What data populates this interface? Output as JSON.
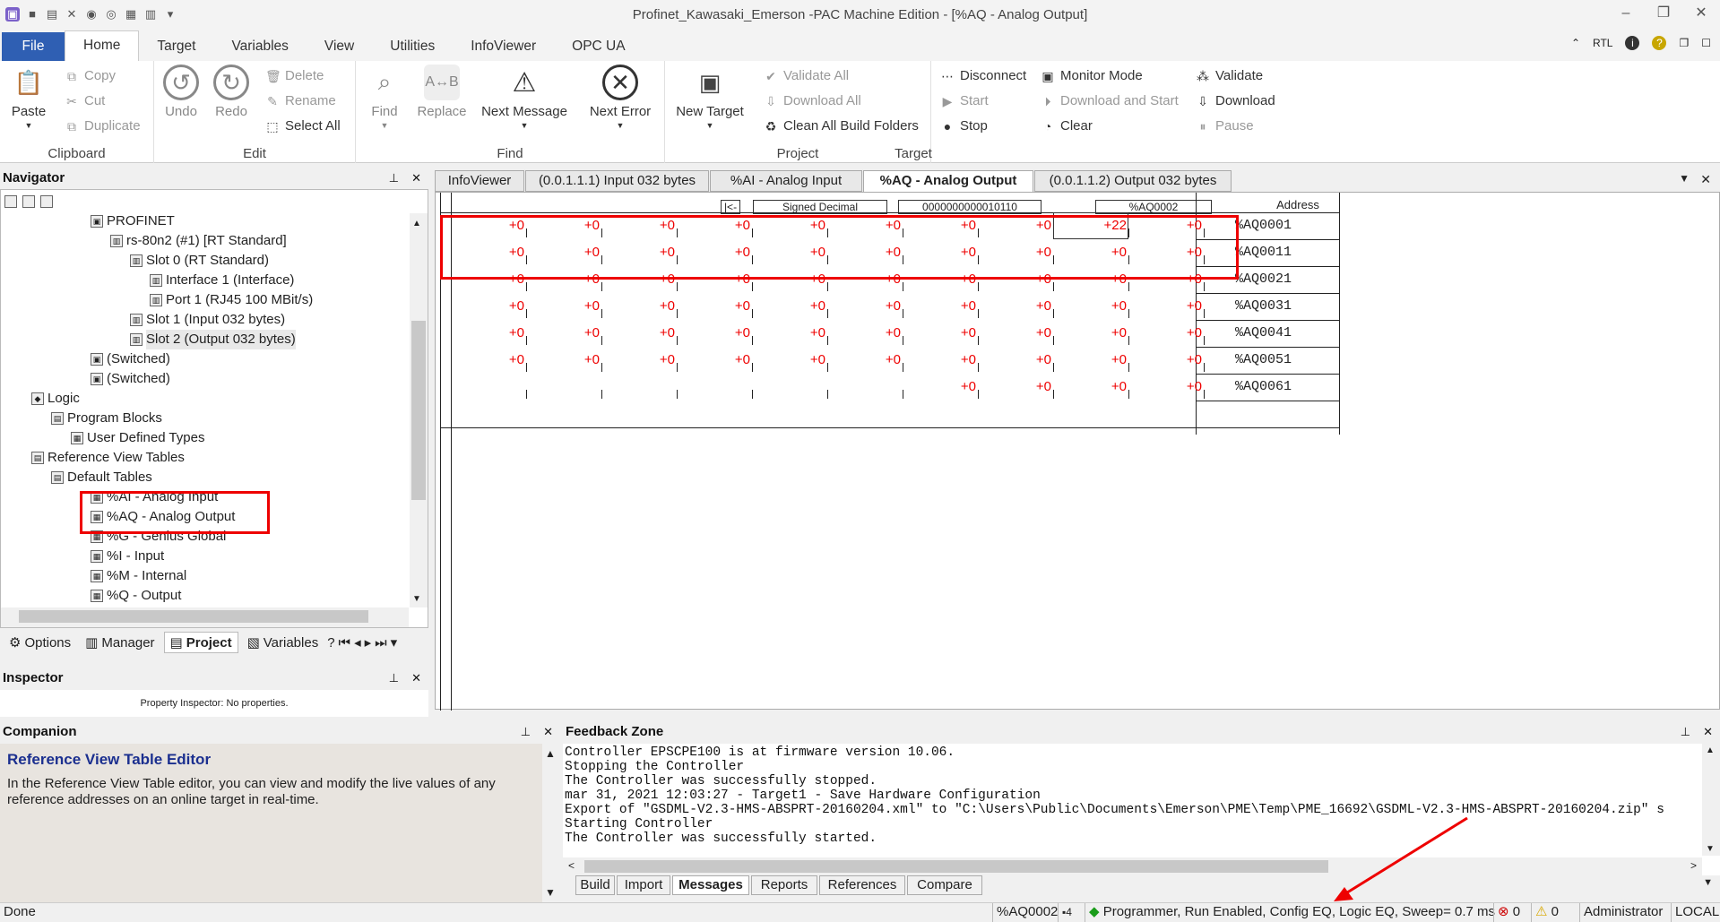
{
  "window": {
    "title": "Profinet_Kawasaki_Emerson -PAC Machine Edition - [%AQ - Analog Output]"
  },
  "ribbon_tabs": [
    "File",
    "Home",
    "Target",
    "Variables",
    "View",
    "Utilities",
    "InfoViewer",
    "OPC UA"
  ],
  "ribbon_right": {
    "rtl": "RTL"
  },
  "ribbon": {
    "clipboard": {
      "label": "Clipboard",
      "paste": "Paste",
      "copy": "Copy",
      "cut": "Cut",
      "duplicate": "Duplicate"
    },
    "edit": {
      "label": "Edit",
      "undo": "Undo",
      "redo": "Redo",
      "delete": "Delete",
      "rename": "Rename",
      "select_all": "Select All"
    },
    "find": {
      "label": "Find",
      "find": "Find",
      "replace": "Replace",
      "next_message": "Next Message",
      "next_error": "Next Error"
    },
    "project": {
      "label": "Project",
      "new_target": "New Target",
      "validate_all": "Validate All",
      "download_all": "Download All",
      "clean_all": "Clean All Build Folders"
    },
    "target": {
      "label": "Target",
      "disconnect": "Disconnect",
      "start": "Start",
      "stop": "Stop",
      "monitor_mode": "Monitor Mode",
      "download_and_start": "Download and Start",
      "clear": "Clear",
      "validate": "Validate",
      "download": "Download",
      "pause": "Pause"
    }
  },
  "navigator": {
    "title": "Navigator",
    "tree": [
      {
        "label": "PROFINET",
        "indent": 5
      },
      {
        "label": "rs-80n2 (#1) [RT Standard]",
        "indent": 6
      },
      {
        "label": "Slot   0 (RT Standard)",
        "indent": 7
      },
      {
        "label": "Interface   1 (Interface)",
        "indent": 8
      },
      {
        "label": "Port   1 (RJ45 100 MBit/s)",
        "indent": 8
      },
      {
        "label": "Slot   1 (Input 032 bytes)",
        "indent": 7
      },
      {
        "label": "Slot   2 (Output 032 bytes)",
        "indent": 7
      },
      {
        "label": "(Switched)",
        "indent": 5
      },
      {
        "label": "(Switched)",
        "indent": 5
      },
      {
        "label": "Logic",
        "indent": 2
      },
      {
        "label": "Program Blocks",
        "indent": 3
      },
      {
        "label": "User Defined Types",
        "indent": 4
      },
      {
        "label": "Reference View Tables",
        "indent": 2
      },
      {
        "label": "Default Tables",
        "indent": 3
      },
      {
        "label": "%AI - Analog Input",
        "indent": 5
      },
      {
        "label": "%AQ - Analog Output",
        "indent": 5
      },
      {
        "label": "%G - Genius Global",
        "indent": 5
      },
      {
        "label": "%I - Input",
        "indent": 5
      },
      {
        "label": "%M - Internal",
        "indent": 5
      },
      {
        "label": "%Q - Output",
        "indent": 5
      }
    ],
    "tabs": [
      "Options",
      "Manager",
      "Project",
      "Variables"
    ]
  },
  "inspector": {
    "title": "Inspector",
    "text": "Property Inspector: No properties."
  },
  "doc_tabs": [
    "InfoViewer",
    "(0.0.1.1.1) Input 032 bytes",
    "%AI - Analog Input",
    "%AQ - Analog Output",
    "(0.0.1.1.2) Output 032 bytes"
  ],
  "ref_table": {
    "back_btn": "|<-",
    "format": "Signed Decimal",
    "binary": "0000000000010110",
    "selected_addr": "%AQ0002",
    "address_header": "Address",
    "rows": [
      {
        "values": [
          "+0",
          "+0",
          "+0",
          "+0",
          "+0",
          "+0",
          "+0",
          "+0",
          "+22",
          "+0"
        ],
        "address": "%AQ0001"
      },
      {
        "values": [
          "+0",
          "+0",
          "+0",
          "+0",
          "+0",
          "+0",
          "+0",
          "+0",
          "+0",
          "+0"
        ],
        "address": "%AQ0011"
      },
      {
        "values": [
          "+0",
          "+0",
          "+0",
          "+0",
          "+0",
          "+0",
          "+0",
          "+0",
          "+0",
          "+0"
        ],
        "address": "%AQ0021"
      },
      {
        "values": [
          "+0",
          "+0",
          "+0",
          "+0",
          "+0",
          "+0",
          "+0",
          "+0",
          "+0",
          "+0"
        ],
        "address": "%AQ0031"
      },
      {
        "values": [
          "+0",
          "+0",
          "+0",
          "+0",
          "+0",
          "+0",
          "+0",
          "+0",
          "+0",
          "+0"
        ],
        "address": "%AQ0041"
      },
      {
        "values": [
          "+0",
          "+0",
          "+0",
          "+0",
          "+0",
          "+0",
          "+0",
          "+0",
          "+0",
          "+0"
        ],
        "address": "%AQ0051"
      },
      {
        "values": [
          "",
          "",
          "",
          "",
          "",
          "",
          "+0",
          "+0",
          "+0",
          "+0"
        ],
        "address": "%AQ0061"
      }
    ]
  },
  "companion": {
    "title": "Companion",
    "heading": "Reference View Table Editor",
    "body": "In the Reference View Table editor, you can view and modify the live values of any reference addresses on an online target in real-time."
  },
  "feedback": {
    "title": "Feedback Zone",
    "lines": [
      "Controller EPSCPE100 is at firmware version 10.06.",
      "Stopping the Controller",
      "The Controller was successfully stopped.",
      "mar 31, 2021 12:03:27 - Target1 - Save Hardware Configuration",
      "Export of \"GSDML-V2.3-HMS-ABSPRT-20160204.xml\" to \"C:\\Users\\Public\\Documents\\Emerson\\PME\\Temp\\PME_16692\\GSDML-V2.3-HMS-ABSPRT-20160204.zip\" s",
      "Starting Controller",
      "The Controller was successfully started."
    ],
    "tabs": [
      "Build",
      "Import",
      "Messages",
      "Reports",
      "References",
      "Compare"
    ]
  },
  "status": {
    "left": "Done",
    "addr": "%AQ0002",
    "num": "4",
    "state": "Programmer, Run Enabled, Config EQ, Logic EQ, Sweep=  0.7 ms",
    "errors": "0",
    "warnings": "0",
    "user": "Administrator",
    "mode": "LOCAL"
  }
}
